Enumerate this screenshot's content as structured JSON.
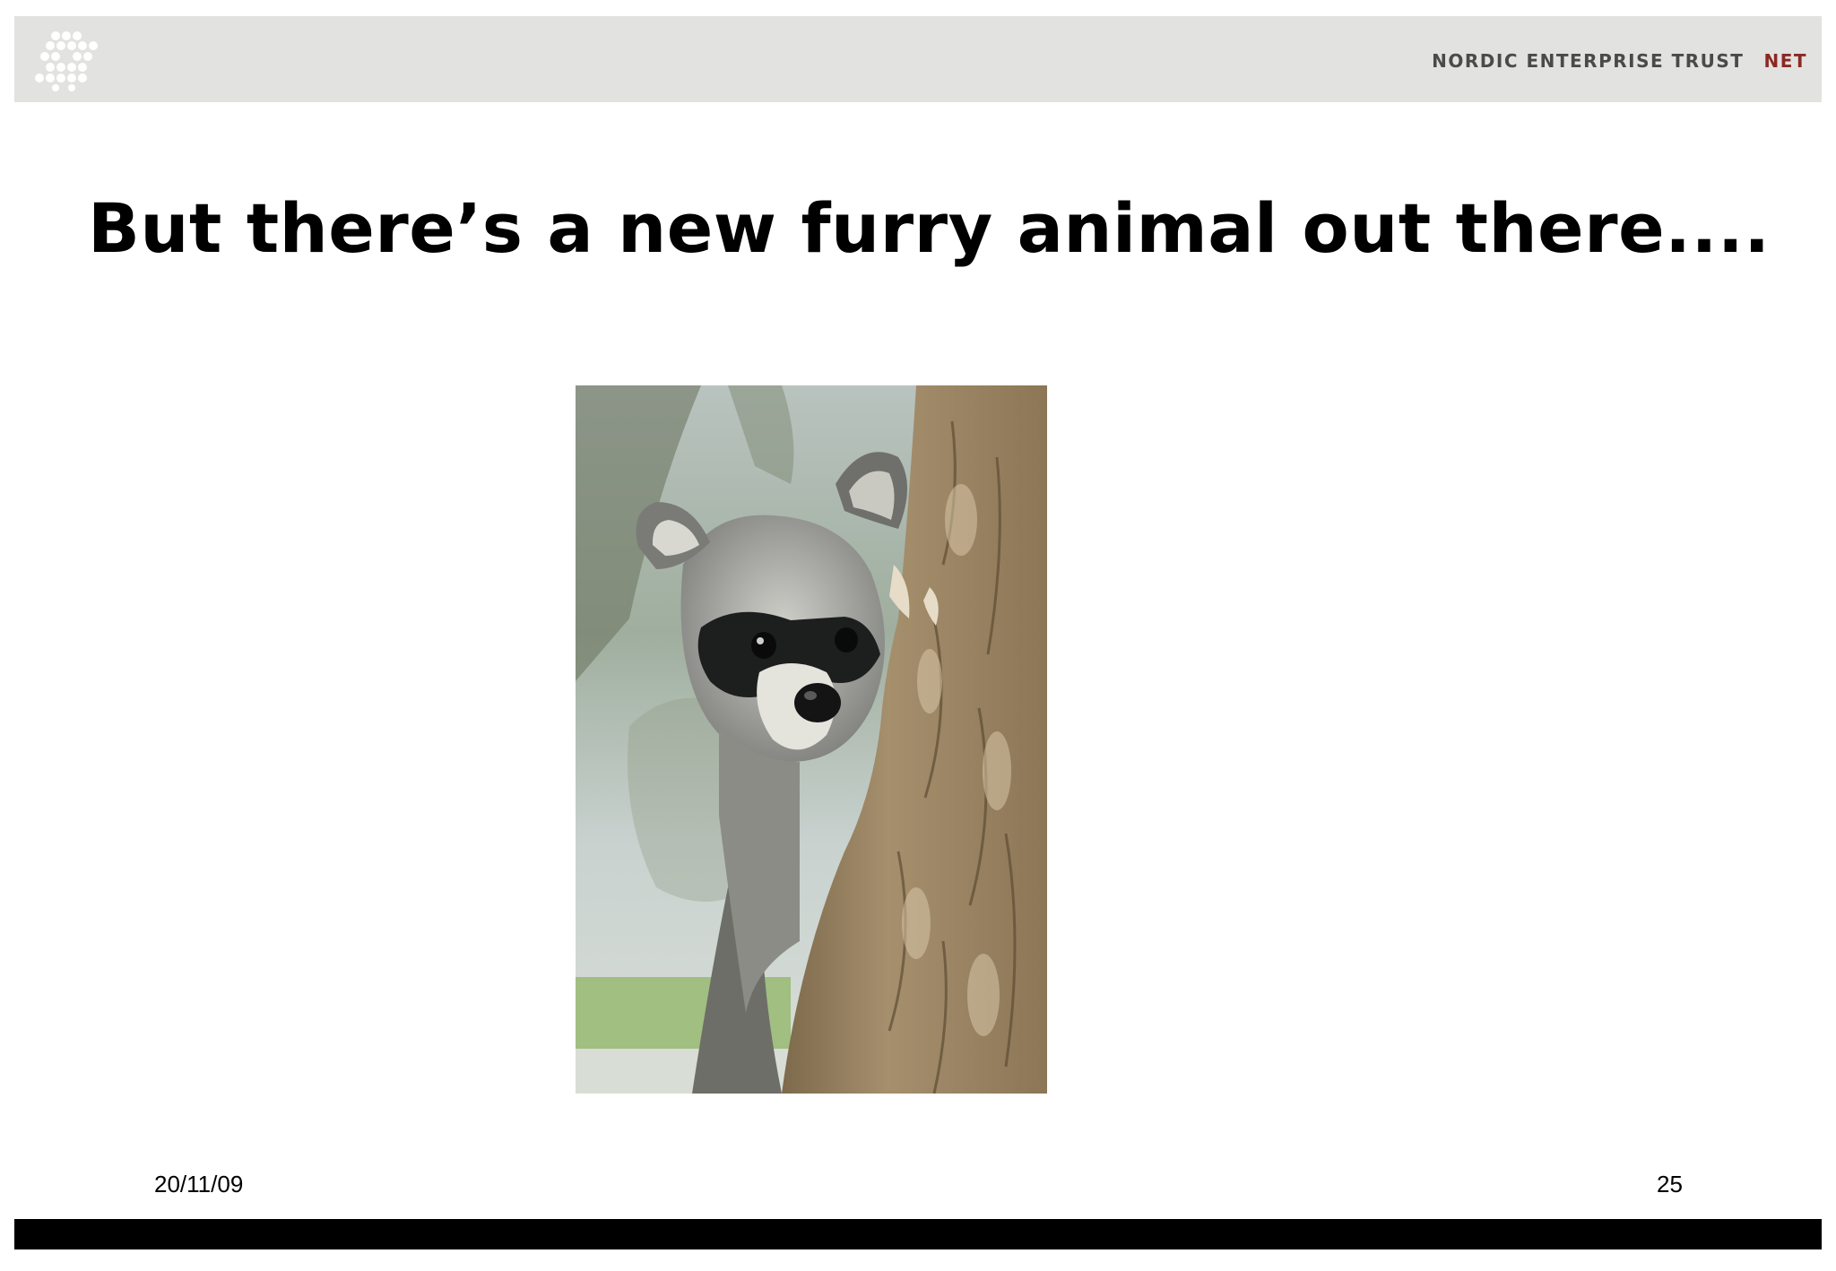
{
  "header": {
    "brand_name": "NORDIC ENTERPRISE TRUST",
    "brand_short": "NET",
    "logo_icon": "dot-grid-logo-icon",
    "background_color": "#e2e2e0",
    "accent_color": "#8a2a22"
  },
  "slide": {
    "title": "But there’s a new furry animal out there....",
    "image": {
      "subject": "raccoon-photo"
    }
  },
  "footer": {
    "date": "20/11/09",
    "page_number": "25",
    "bar_color": "#000000"
  }
}
